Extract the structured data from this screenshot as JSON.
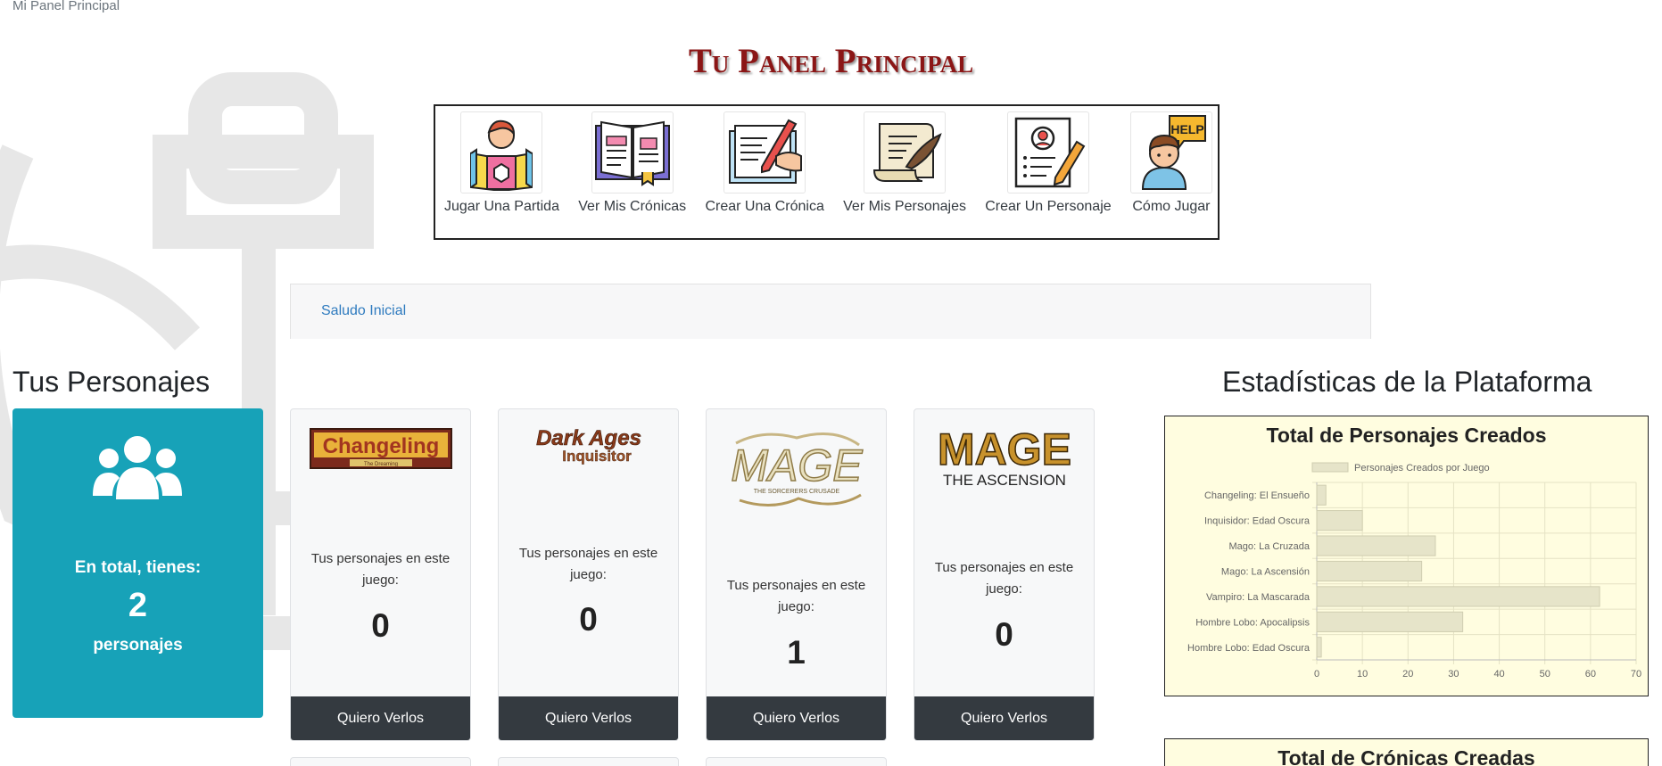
{
  "breadcrumb": "Mi Panel Principal",
  "page_title": "Tu Panel Principal",
  "nav": [
    {
      "label": "Jugar Una Partida",
      "icon": "reader-book-icon"
    },
    {
      "label": "Ver Mis Crónicas",
      "icon": "open-book-icon"
    },
    {
      "label": "Crear Una Crónica",
      "icon": "writing-hand-icon"
    },
    {
      "label": "Ver Mis Personajes",
      "icon": "scroll-quill-icon"
    },
    {
      "label": "Crear Un Personaje",
      "icon": "profile-pencil-icon"
    },
    {
      "label": "Cómo Jugar",
      "icon": "help-person-icon"
    }
  ],
  "greeting_link": "Saludo Inicial",
  "characters": {
    "heading": "Tus Personajes",
    "summary": {
      "intro": "En total, tienes:",
      "count": "2",
      "unit": "personajes",
      "icon": "users-icon",
      "color": "#17a2b8"
    },
    "cards": [
      {
        "logo": "Changeling",
        "logo_sub": "The Dreaming",
        "text": "Tus personajes en este juego:",
        "count": "0",
        "button": "Quiero Verlos"
      },
      {
        "logo": "Dark Ages",
        "logo_sub": "Inquisitor",
        "text": "Tus personajes en este juego:",
        "count": "0",
        "button": "Quiero Verlos"
      },
      {
        "logo": "MAGE",
        "logo_sub": "THE SORCERERS CRUSADE",
        "text": "Tus personajes en este juego:",
        "count": "1",
        "button": "Quiero Verlos"
      },
      {
        "logo": "MAGE",
        "logo_sub": "THE ASCENSION",
        "text": "Tus personajes en este juego:",
        "count": "0",
        "button": "Quiero Verlos"
      }
    ]
  },
  "stats": {
    "heading": "Estadísticas de la Plataforma",
    "chart2_title": "Total de Crónicas Creadas"
  },
  "chart_data": {
    "type": "bar",
    "orientation": "horizontal",
    "title": "Total de Personajes Creados",
    "legend": "Personajes Creados por Juego",
    "legend_position": "top",
    "grid": true,
    "categories": [
      "Changeling: El Ensueño",
      "Inquisidor: Edad Oscura",
      "Mago: La Cruzada",
      "Mago: La Ascensión",
      "Vampiro: La Mascarada",
      "Hombre Lobo: Apocalipsis",
      "Hombre Lobo: Edad Oscura"
    ],
    "series": [
      {
        "name": "Personajes Creados por Juego",
        "values": [
          2,
          10,
          26,
          23,
          62,
          32,
          1
        ]
      }
    ],
    "xlim": [
      0,
      70
    ],
    "xticks": [
      "0",
      "10",
      "20",
      "30",
      "40",
      "50",
      "60",
      "70"
    ],
    "bar_color": "#e6e4c9",
    "bar_border": "#cfcdb0"
  }
}
